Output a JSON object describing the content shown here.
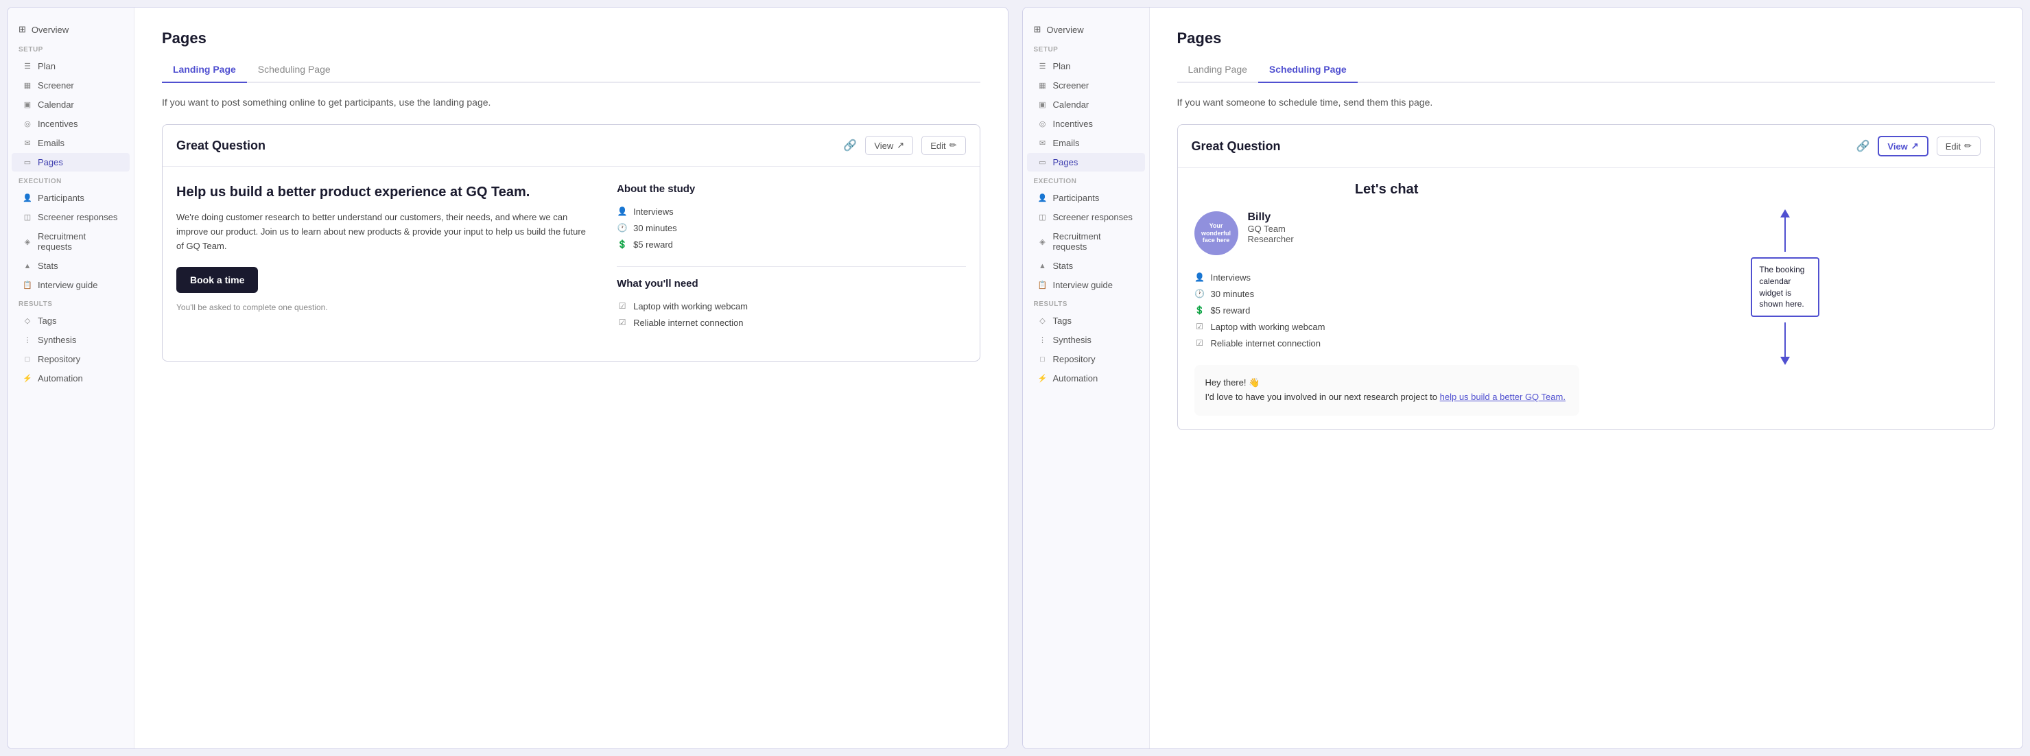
{
  "panels": [
    {
      "id": "landing-panel",
      "sidebar": {
        "overview": "Overview",
        "sections": [
          {
            "label": "Setup",
            "items": [
              {
                "icon": "plan-icon",
                "label": "Plan",
                "active": false
              },
              {
                "icon": "screener-icon",
                "label": "Screener",
                "active": false
              },
              {
                "icon": "calendar-icon",
                "label": "Calendar",
                "active": false
              },
              {
                "icon": "incentives-icon",
                "label": "Incentives",
                "active": false
              },
              {
                "icon": "emails-icon",
                "label": "Emails",
                "active": false
              },
              {
                "icon": "pages-icon",
                "label": "Pages",
                "active": true
              }
            ]
          },
          {
            "label": "Execution",
            "items": [
              {
                "icon": "participants-icon",
                "label": "Participants",
                "active": false
              },
              {
                "icon": "screener-responses-icon",
                "label": "Screener responses",
                "active": false
              },
              {
                "icon": "recruitment-icon",
                "label": "Recruitment requests",
                "active": false
              },
              {
                "icon": "stats-icon",
                "label": "Stats",
                "active": false
              },
              {
                "icon": "interview-guide-icon",
                "label": "Interview guide",
                "active": false
              }
            ]
          },
          {
            "label": "Results",
            "items": [
              {
                "icon": "tags-icon",
                "label": "Tags",
                "active": false
              },
              {
                "icon": "synthesis-icon",
                "label": "Synthesis",
                "active": false
              },
              {
                "icon": "repository-icon",
                "label": "Repository",
                "active": false
              }
            ]
          },
          {
            "label": "",
            "items": [
              {
                "icon": "automation-icon",
                "label": "Automation",
                "active": false
              }
            ]
          }
        ]
      },
      "main": {
        "title": "Pages",
        "tabs": [
          {
            "label": "Landing Page",
            "active": true
          },
          {
            "label": "Scheduling Page",
            "active": false
          }
        ],
        "description": "If you want to post something online to get participants, use the landing page.",
        "card": {
          "logo": "Great Question",
          "actions": {
            "link_icon": "🔗",
            "view_label": "View",
            "edit_label": "Edit"
          },
          "headline": "Help us build a better product experience at GQ Team.",
          "body": "We're doing customer research to better understand our customers, their needs, and where we can improve our product. Join us to learn about new products & provide your input to help us build the future of GQ Team.",
          "book_btn": "Book a time",
          "footer_text": "You'll be asked to complete one question.",
          "about_title": "About the study",
          "about_items": [
            {
              "icon": "person-icon",
              "label": "Interviews"
            },
            {
              "icon": "clock-icon",
              "label": "30 minutes"
            },
            {
              "icon": "dollar-icon",
              "label": "$5 reward"
            }
          ],
          "needs_title": "What you'll need",
          "needs_items": [
            {
              "icon": "check-icon",
              "label": "Laptop with working webcam"
            },
            {
              "icon": "check-icon",
              "label": "Reliable internet connection"
            }
          ]
        }
      }
    },
    {
      "id": "scheduling-panel",
      "sidebar": {
        "overview": "Overview",
        "sections": [
          {
            "label": "Setup",
            "items": [
              {
                "icon": "plan-icon",
                "label": "Plan",
                "active": false
              },
              {
                "icon": "screener-icon",
                "label": "Screener",
                "active": false
              },
              {
                "icon": "calendar-icon",
                "label": "Calendar",
                "active": false
              },
              {
                "icon": "incentives-icon",
                "label": "Incentives",
                "active": false
              },
              {
                "icon": "emails-icon",
                "label": "Emails",
                "active": false
              },
              {
                "icon": "pages-icon",
                "label": "Pages",
                "active": true
              }
            ]
          },
          {
            "label": "Execution",
            "items": [
              {
                "icon": "participants-icon",
                "label": "Participants",
                "active": false
              },
              {
                "icon": "screener-responses-icon",
                "label": "Screener responses",
                "active": false
              },
              {
                "icon": "recruitment-icon",
                "label": "Recruitment requests",
                "active": false
              },
              {
                "icon": "stats-icon",
                "label": "Stats",
                "active": false
              },
              {
                "icon": "interview-guide-icon",
                "label": "Interview guide",
                "active": false
              }
            ]
          },
          {
            "label": "Results",
            "items": [
              {
                "icon": "tags-icon",
                "label": "Tags",
                "active": false
              },
              {
                "icon": "synthesis-icon",
                "label": "Synthesis",
                "active": false
              },
              {
                "icon": "repository-icon",
                "label": "Repository",
                "active": false
              }
            ]
          },
          {
            "label": "",
            "items": [
              {
                "icon": "automation-icon",
                "label": "Automation",
                "active": false
              }
            ]
          }
        ]
      },
      "main": {
        "title": "Pages",
        "tabs": [
          {
            "label": "Landing Page",
            "active": false
          },
          {
            "label": "Scheduling Page",
            "active": true
          }
        ],
        "description": "If you want someone to schedule time, send them this page.",
        "card": {
          "logo": "Great Question",
          "actions": {
            "link_icon": "🔗",
            "view_label": "View",
            "edit_label": "Edit"
          },
          "lets_chat": "Let's chat",
          "avatar_text": "Your wonderful face here",
          "researcher_name": "Billy",
          "researcher_team": "GQ Team",
          "researcher_role": "Researcher",
          "about_items": [
            {
              "icon": "person-icon",
              "label": "Interviews"
            },
            {
              "icon": "clock-icon",
              "label": "30 minutes"
            },
            {
              "icon": "dollar-icon",
              "label": "$5 reward"
            },
            {
              "icon": "check-icon",
              "label": "Laptop with working webcam"
            },
            {
              "icon": "check-icon",
              "label": "Reliable internet connection"
            }
          ],
          "chat_text_1": "Hey there! 👋",
          "chat_text_2": "I'd love to have you involved in our next research project to",
          "chat_link": "help us build a better GQ Team.",
          "annotation": "The booking calendar widget is shown here.",
          "annotation_arrow_label": "↑↓"
        }
      }
    }
  ]
}
